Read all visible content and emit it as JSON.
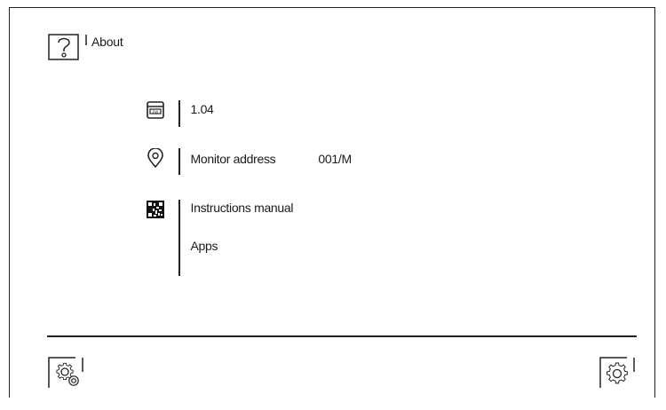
{
  "header": {
    "title": "About"
  },
  "version": {
    "value": "1.04"
  },
  "address": {
    "label": "Monitor address",
    "value": "001/M"
  },
  "documentation": {
    "items": [
      {
        "label": "Instructions manual"
      },
      {
        "label": "Apps"
      }
    ]
  },
  "footer": {
    "left_icon": "gear-settings-icon",
    "right_icon": "gear-icon"
  },
  "icons": {
    "help": "question-mark-icon",
    "version": "firmware-icon",
    "address": "location-pin-icon",
    "docs": "qr-code-icon"
  }
}
